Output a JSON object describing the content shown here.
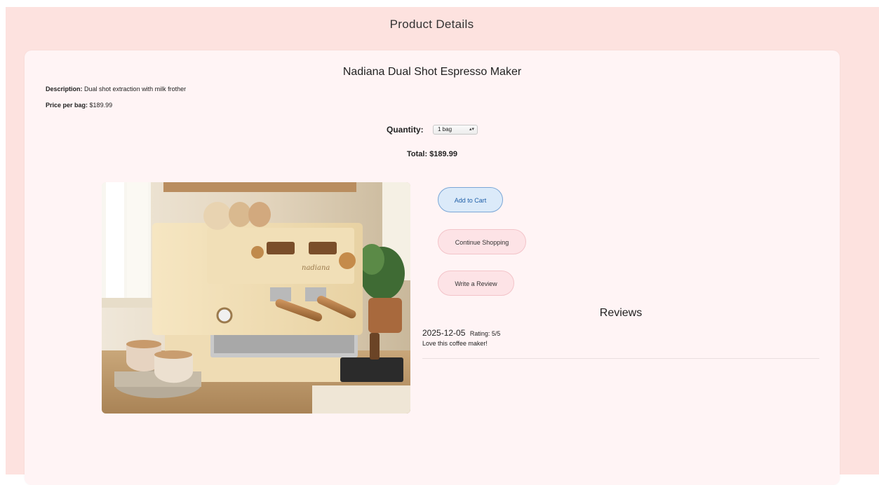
{
  "header": {
    "title": "Product Details"
  },
  "product": {
    "name": "Nadiana Dual Shot Espresso Maker",
    "description_label": "Description:",
    "description": "Dual shot extraction with milk frother",
    "price_label": "Price per bag:",
    "price": "$189.99",
    "brand_mark": "nadiana"
  },
  "quantity": {
    "label": "Quantity:",
    "selected": "1 bag"
  },
  "total": "Total: $189.99",
  "actions": {
    "add_to_cart": "Add to Cart",
    "continue_shopping": "Continue Shopping",
    "write_review": "Write a Review"
  },
  "reviews": {
    "heading": "Reviews",
    "items": [
      {
        "date": "2025-12-05",
        "rating": "Rating: 5/5",
        "text": "Love this coffee maker!"
      }
    ]
  },
  "colors": {
    "page_bg": "#fde2df",
    "card_bg": "#fff4f5",
    "primary_button": "#dbeaf9",
    "primary_border": "#7aa6d6",
    "secondary_button": "#fde3e6"
  }
}
